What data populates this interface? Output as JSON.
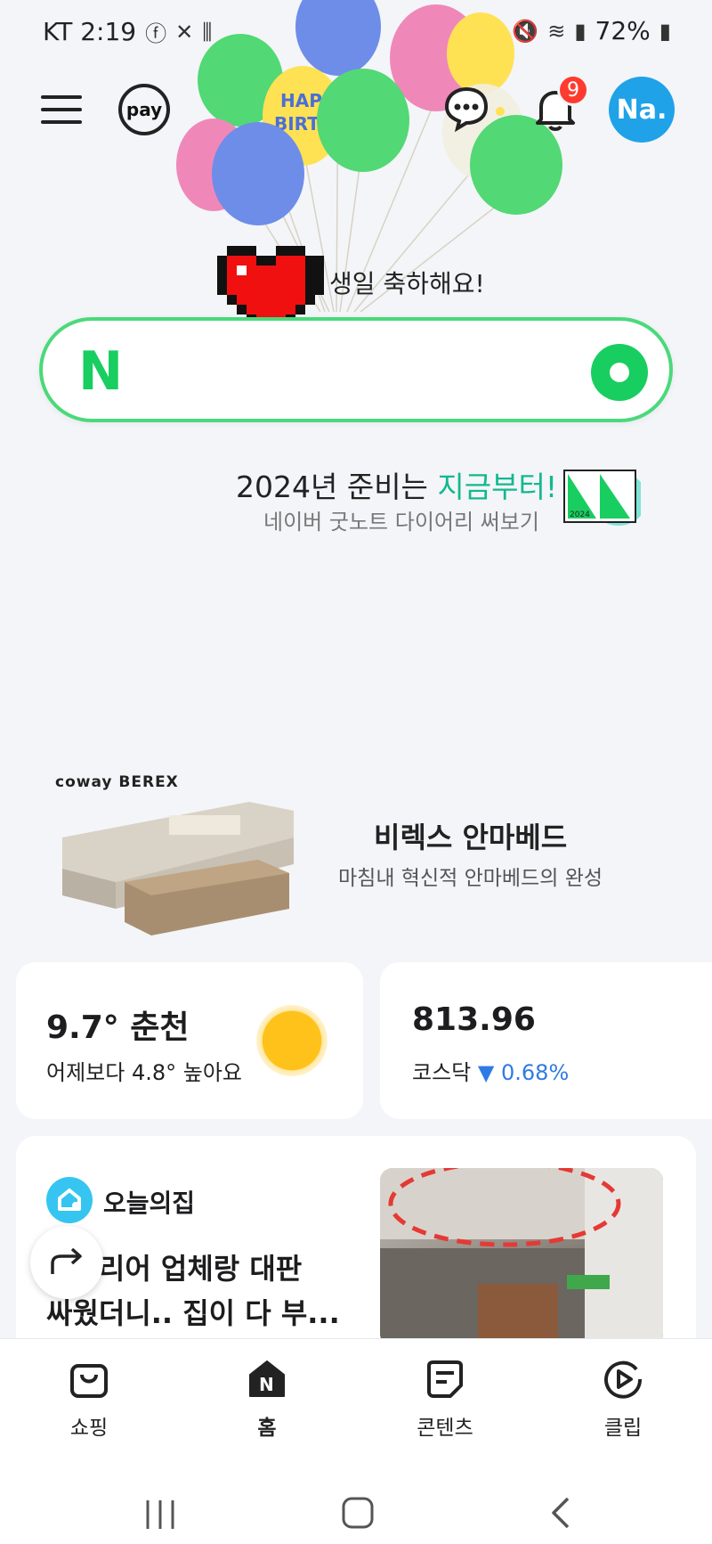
{
  "status_bar": {
    "carrier_time": "KT 2:19",
    "battery": "72%"
  },
  "header": {
    "pay_label": "pay",
    "notification_count": "9",
    "avatar_label": "Na."
  },
  "birthday": {
    "message": "생일 축하해요!"
  },
  "search": {
    "logo": "N"
  },
  "promo": {
    "title_prefix": "2024년 준비는 ",
    "title_highlight": "지금부터!",
    "subtitle": "네이버 굿노트 다이어리 써보기",
    "thumb_label": "2024"
  },
  "ad": {
    "brand": "coway BEREX",
    "title": "비렉스 안마베드",
    "subtitle": "마침내 혁신적 안마베드의 완성"
  },
  "weather": {
    "temp_city": "9.7° 춘천",
    "comparison": "어제보다 4.8° 높아요"
  },
  "stock": {
    "value": "813.96",
    "index_name": "코스닥",
    "change": "0.68%",
    "direction": "down"
  },
  "news": {
    "source": "오늘의집",
    "headline_line1": "인테리어 업체랑 대판",
    "headline_line2": "싸웠더니.. 집이 다 부..."
  },
  "bottom_nav": {
    "items": [
      {
        "label": "쇼핑",
        "icon": "shopping-bag-icon"
      },
      {
        "label": "홈",
        "icon": "home-n-icon"
      },
      {
        "label": "콘텐츠",
        "icon": "contents-icon"
      },
      {
        "label": "클립",
        "icon": "clip-play-icon"
      }
    ]
  },
  "colors": {
    "naver_green": "#19ce60",
    "accent_teal": "#13b88f",
    "stock_down": "#2f7be5",
    "badge_red": "#ff3b30",
    "avatar_blue": "#1fa2e8"
  }
}
